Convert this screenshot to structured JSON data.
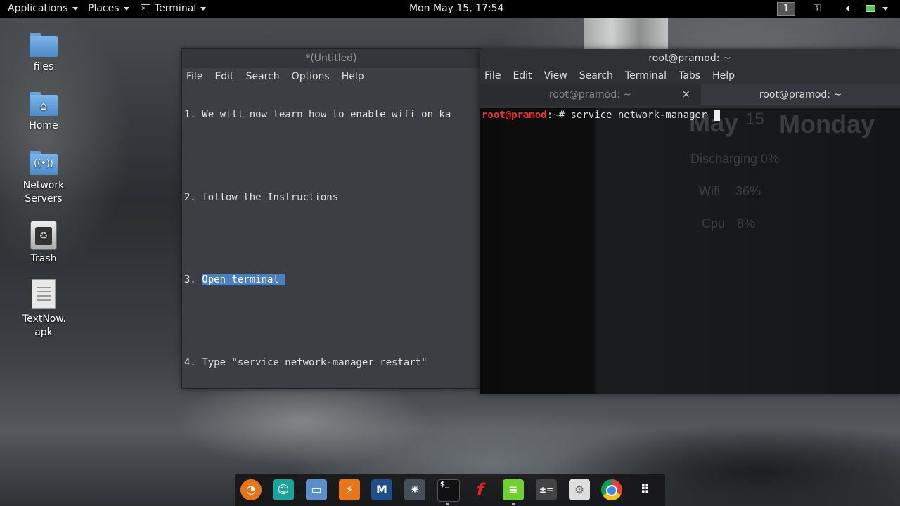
{
  "topbar": {
    "applications": "Applications",
    "places": "Places",
    "terminal_menu": "Terminal",
    "clock": "Mon May 15, 17:54",
    "workspace": "1",
    "status_icons": [
      "key-icon",
      "volume-icon",
      "battery-icon",
      "power-icon"
    ]
  },
  "desktop": {
    "icons": [
      {
        "label": "files",
        "icon": "folder-icon"
      },
      {
        "label": "Home",
        "icon": "home-folder-icon"
      },
      {
        "label": "Network Servers",
        "icon": "network-folder-icon"
      },
      {
        "label": "Trash",
        "icon": "trash-icon"
      },
      {
        "label": "TextNow. apk",
        "icon": "file-icon"
      }
    ]
  },
  "gedit": {
    "title": "*(Untitled)",
    "menu": [
      "File",
      "Edit",
      "Search",
      "Options",
      "Help"
    ],
    "lines": [
      "1. We will now learn how to enable wifi on ka",
      "",
      "2. follow the Instructions",
      "",
      "3. ",
      "",
      "4. Type \"service network-manager restart\""
    ],
    "selected_text": "Open terminal "
  },
  "terminal": {
    "title": "root@pramod: ~",
    "menu": [
      "File",
      "Edit",
      "View",
      "Search",
      "Terminal",
      "Tabs",
      "Help"
    ],
    "tabs": [
      "root@pramod: ~",
      "root@pramod: ~"
    ],
    "prompt_user": "root@pramod",
    "prompt_path": ":~# ",
    "command": "service network-manager ",
    "conky": {
      "month": "May",
      "day": "15",
      "weekday": "Monday",
      "battery": "Discharging 0%",
      "wifi_label": "Wifi",
      "wifi_value": "36%",
      "cpu_label": "Cpu",
      "cpu_value": "8%"
    }
  },
  "dock": {
    "apps": [
      "firefox-icon",
      "kali-avatar-icon",
      "files-icon",
      "burpsuite-icon",
      "metasploit-icon",
      "armitage-icon",
      "terminal-icon",
      "faraday-icon",
      "notes-icon",
      "calculator-icon",
      "settings-icon",
      "chrome-icon",
      "app-grid-icon"
    ]
  },
  "colors": {
    "selection": "#4a7fc1",
    "prompt_red": "#e33333"
  }
}
